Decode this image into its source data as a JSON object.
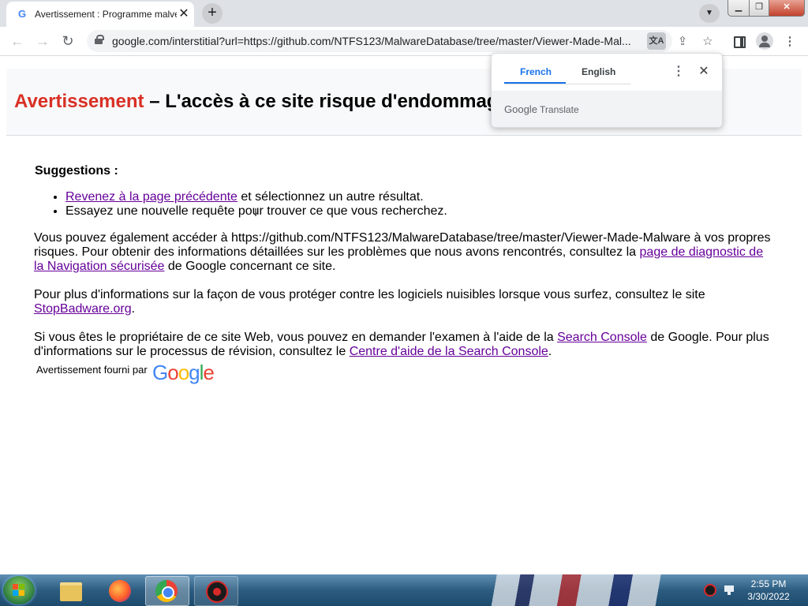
{
  "browser": {
    "tab_title": "Avertissement : Programme malveillant",
    "tab_favicon": "G",
    "new_tab_label": "+",
    "url": "google.com/interstitial?url=https://github.com/NTFS123/MalwareDatabase/tree/master/Viewer-Made-Mal...",
    "url_path": "https://github.com/NTFS123/MalwareDatabase/tree/master/Viewer-Made-Malware"
  },
  "page": {
    "title_red": "Avertissement",
    "title_rest": " – L'accès à ce site risque d'endommager votre ordinateur !",
    "suggestions_heading": "Suggestions :",
    "suggestion1_link": "Revenez à la page précédente",
    "suggestion1_rest": " et sélectionnez un autre résultat.",
    "suggestion2": "Essayez une nouvelle requête pour trouver ce que vous recherchez.",
    "p1_pre": "Vous pouvez également accéder à https://github.com/NTFS123/MalwareDatabase/tree/master/Viewer-Made-Malware à vos propres risques. Pour obtenir des informations détaillées sur les problèmes que nous avons rencontrés, consultez la ",
    "p1_link": "page de diagnostic de la Navigation sécurisée",
    "p1_post": " de Google concernant ce site.",
    "p2_pre": "Pour plus d'informations sur la façon de vous protéger contre les logiciels nuisibles lorsque vous surfez, consultez le site ",
    "p2_link": "StopBadware.org",
    "p2_post": ".",
    "p3_pre": "Si vous êtes le propriétaire de ce site Web, vous pouvez en demander l'examen à l'aide de la ",
    "p3_link1": "Search Console",
    "p3_mid": " de Google. Pour plus d'informations sur le processus de révision, consultez le ",
    "p3_link2": "Centre d'aide de la Search Console",
    "p3_post": ".",
    "provided_by": "Avertissement fourni par",
    "google_logo": [
      "G",
      "o",
      "o",
      "g",
      "l",
      "e"
    ]
  },
  "translate": {
    "tab_source": "French",
    "tab_target": "English",
    "brand_google": "Google",
    "brand_translate": " Translate"
  },
  "taskbar": {
    "time": "2:55 PM",
    "date": "3/30/2022"
  }
}
